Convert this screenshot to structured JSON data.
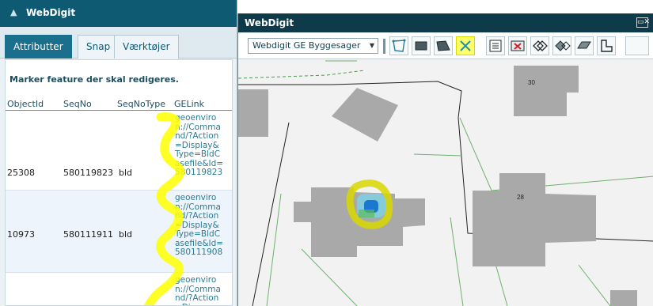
{
  "left": {
    "title": "WebDigit",
    "tabs": [
      {
        "label": "Attributter",
        "active": true
      },
      {
        "label": "Snap",
        "active": false
      },
      {
        "label": "Værktøjer",
        "active": false
      }
    ],
    "instruction": "Marker feature der skal redigeres.",
    "columns": [
      "ObjectId",
      "SeqNo",
      "SeqNoType",
      "GELink"
    ],
    "rows": [
      {
        "objectid": "25308",
        "seqno": "580119823",
        "seqnotype": "bld",
        "gelink": "geoenviron://Command/?Action=Display&Type=BldCasefile&Id=580119823"
      },
      {
        "objectid": "10973",
        "seqno": "580111911",
        "seqnotype": "bld",
        "gelink": "geoenviron://Command/?Action=Display&Type=BldCasefile&Id=580111908"
      },
      {
        "objectid": "",
        "seqno": "",
        "seqnotype": "",
        "gelink": "geoenviron://Command/?Action=Disp"
      }
    ]
  },
  "map_window": {
    "title": "WebDigit",
    "layer_select": "Webdigit GE Byggesager",
    "close_glyph": "▭✕",
    "labels": {
      "building_a": "30",
      "building_b": "28"
    }
  },
  "colors": {
    "header": "#0f5a73",
    "titlebar": "#0e3b4a",
    "highlight": "#ffff00",
    "link": "#2a7b95",
    "building": "#a9a9a9"
  },
  "icons": [
    "polygon-icon",
    "rectangle-icon",
    "edit-polygon-icon",
    "cut-icon",
    "attributes-icon",
    "delete-icon",
    "merge-icon",
    "split-icon",
    "reshape-icon",
    "undo-icon"
  ]
}
